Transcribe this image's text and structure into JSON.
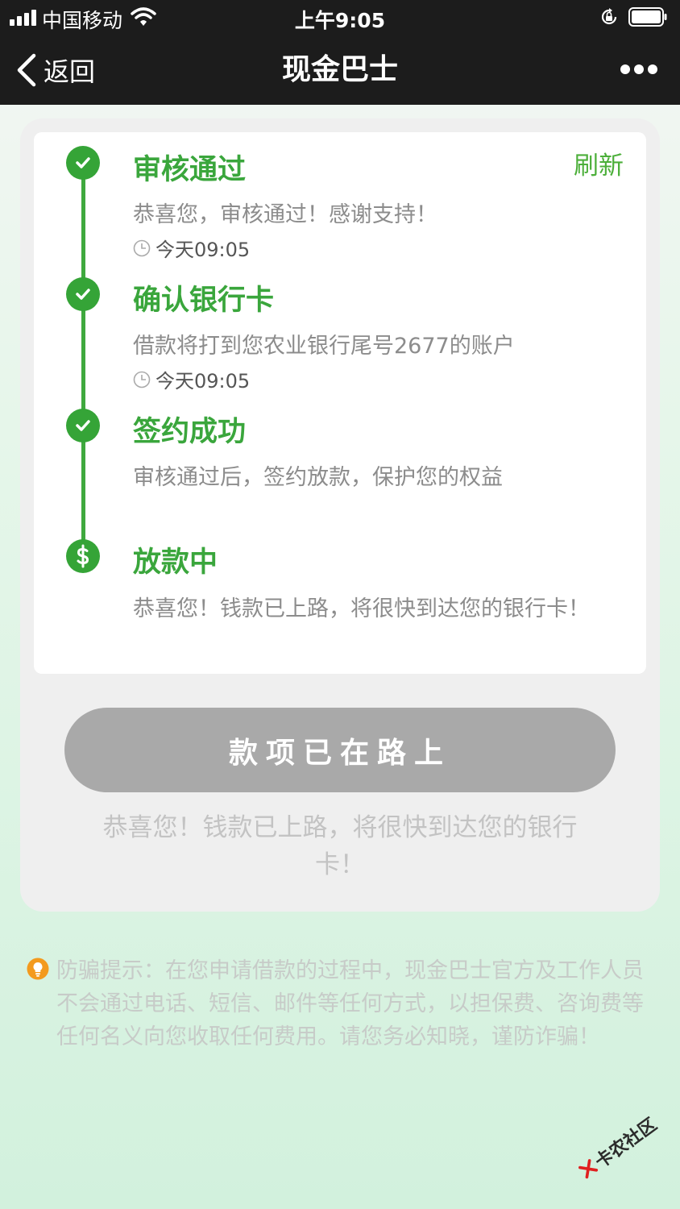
{
  "status_bar": {
    "carrier": "中国移动",
    "time": "上午9:05"
  },
  "nav": {
    "back_label": "返回",
    "title": "现金巴士"
  },
  "progress": {
    "refresh_label": "刷新",
    "steps": [
      {
        "title": "审核通过",
        "desc": "恭喜您，审核通过！感谢支持！",
        "time": "今天09:05",
        "icon": "check-icon"
      },
      {
        "title": "确认银行卡",
        "desc": "借款将打到您农业银行尾号2677的账户",
        "time": "今天09:05",
        "icon": "check-icon"
      },
      {
        "title": "签约成功",
        "desc": "审核通过后，签约放款，保护您的权益",
        "icon": "check-icon"
      },
      {
        "title": "放款中",
        "desc": "恭喜您！钱款已上路，将很快到达您的银行卡！",
        "icon": "dollar-icon"
      }
    ]
  },
  "action": {
    "button_label": "款项已在路上",
    "subtext": "恭喜您！钱款已上路，将很快到达您的银行卡！"
  },
  "notice": {
    "text": "防骗提示：在您申请借款的过程中，现金巴士官方及工作人员不会通过电话、短信、邮件等任何方式，以担保费、咨询费等任何名义向您收取任何费用。请您务必知晓，谨防诈骗！"
  },
  "watermark": {
    "text": "卡农社区"
  },
  "colors": {
    "accent_green": "#3aa63c",
    "nav_bg": "#1c1c1c",
    "button_gray": "#a9a9a9",
    "warning_orange": "#f39a1e"
  }
}
